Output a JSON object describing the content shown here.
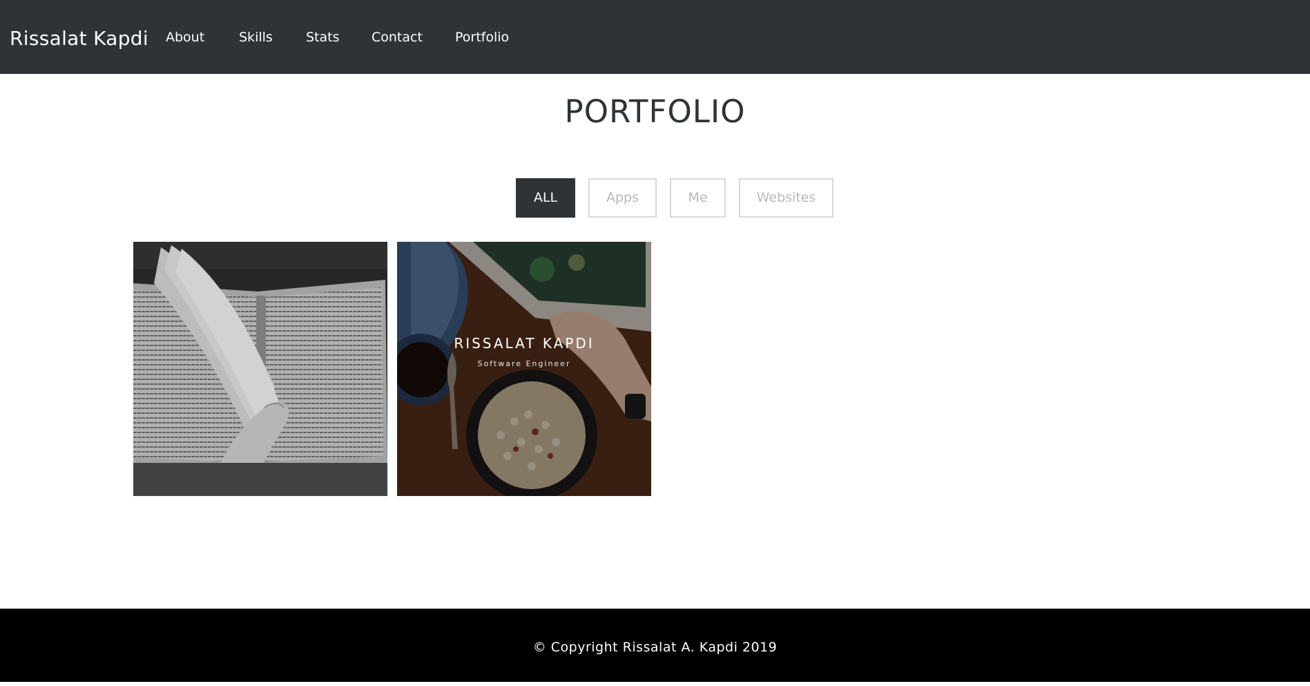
{
  "navbar": {
    "brand": "Rissalat Kapdi",
    "items": [
      {
        "label": "About"
      },
      {
        "label": "Skills"
      },
      {
        "label": "Stats"
      },
      {
        "label": "Contact"
      },
      {
        "label": "Portfolio"
      }
    ],
    "background": "#2d3336"
  },
  "portfolio": {
    "title": "PORTFOLIO",
    "filters": [
      {
        "label": "ALL",
        "active": true
      },
      {
        "label": "Apps",
        "active": false
      },
      {
        "label": "Me",
        "active": false
      },
      {
        "label": "Websites",
        "active": false
      }
    ],
    "items": [
      {
        "image": "open-book-photo"
      },
      {
        "image": "breakfast-table-photo",
        "overlay_title": "RISSALAT KAPDI",
        "overlay_subtitle": "Software Engineer"
      }
    ]
  },
  "footer": {
    "copyright": "© Copyright Rissalat A. Kapdi 2019",
    "background": "#000000"
  }
}
